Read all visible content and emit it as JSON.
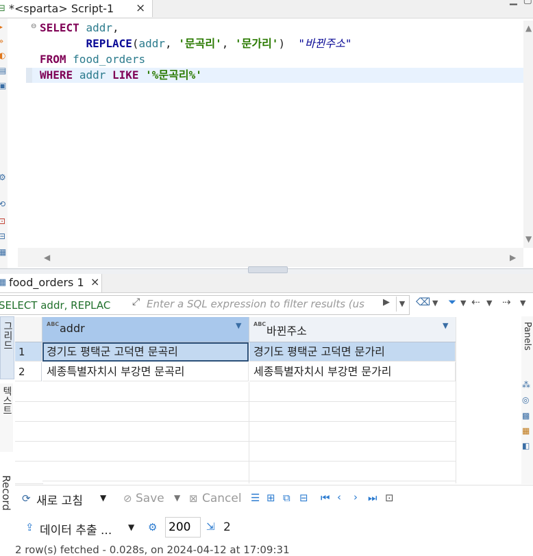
{
  "editor": {
    "tab_title": "*<sparta> Script-1",
    "tab_close": "×",
    "lines": [
      [
        {
          "c": "kw",
          "t": "SELECT"
        },
        {
          "c": "pu",
          "t": " "
        },
        {
          "c": "id",
          "t": "addr"
        },
        {
          "c": "pu",
          "t": ","
        }
      ],
      [
        {
          "c": "pu",
          "t": "       "
        },
        {
          "c": "fn",
          "t": "REPLACE"
        },
        {
          "c": "pu",
          "t": "("
        },
        {
          "c": "id",
          "t": "addr"
        },
        {
          "c": "pu",
          "t": ", "
        },
        {
          "c": "st",
          "t": "'문곡리'"
        },
        {
          "c": "pu",
          "t": ", "
        },
        {
          "c": "st",
          "t": "'문가리'"
        },
        {
          "c": "pu",
          "t": ")  "
        },
        {
          "c": "al",
          "t": "\"바뀐주소\""
        }
      ],
      [
        {
          "c": "kw",
          "t": "FROM"
        },
        {
          "c": "pu",
          "t": " "
        },
        {
          "c": "id",
          "t": "food_orders"
        }
      ],
      [
        {
          "c": "kw",
          "t": "WHERE"
        },
        {
          "c": "pu",
          "t": " "
        },
        {
          "c": "id",
          "t": "addr"
        },
        {
          "c": "pu",
          "t": " "
        },
        {
          "c": "kw",
          "t": "LIKE"
        },
        {
          "c": "pu",
          "t": " "
        },
        {
          "c": "st",
          "t": "'%문곡리%'"
        }
      ]
    ]
  },
  "results": {
    "tab_title": "food_orders 1",
    "tab_close": "×",
    "query_label": "SELECT addr, REPLAC",
    "filter_placeholder": "Enter a SQL expression to filter results (us",
    "columns": [
      {
        "type": "ABC",
        "label": "addr"
      },
      {
        "type": "ABC",
        "label": "바뀐주소"
      }
    ],
    "rows": [
      {
        "num": "1",
        "cells": [
          "경기도 평택군 고덕면 문곡리",
          "경기도 평택군 고덕면 문가리"
        ]
      },
      {
        "num": "2",
        "cells": [
          "세종특별자치시 부강면 문곡리",
          "세종특별자치시 부강면 문가리"
        ]
      }
    ],
    "side_tabs": {
      "grid": "그리드",
      "text": "텍스트",
      "record": "Record"
    },
    "panels_label": "Panels"
  },
  "toolbar": {
    "refresh_label": "새로 고침",
    "save_label": "Save",
    "cancel_label": "Cancel",
    "export_label": "데이터 추출 ...",
    "fetch_size": "200",
    "row_count": "2"
  },
  "status": {
    "text": "2 row(s) fetched - 0.028s, on 2024-04-12 at 17:09:31"
  },
  "colors": {
    "keyword": "#7f0055",
    "string": "#2a7a00",
    "identifier": "#2a7a8c",
    "selected_header": "#a9c8ec",
    "selected_cell": "#c3d9f1"
  }
}
